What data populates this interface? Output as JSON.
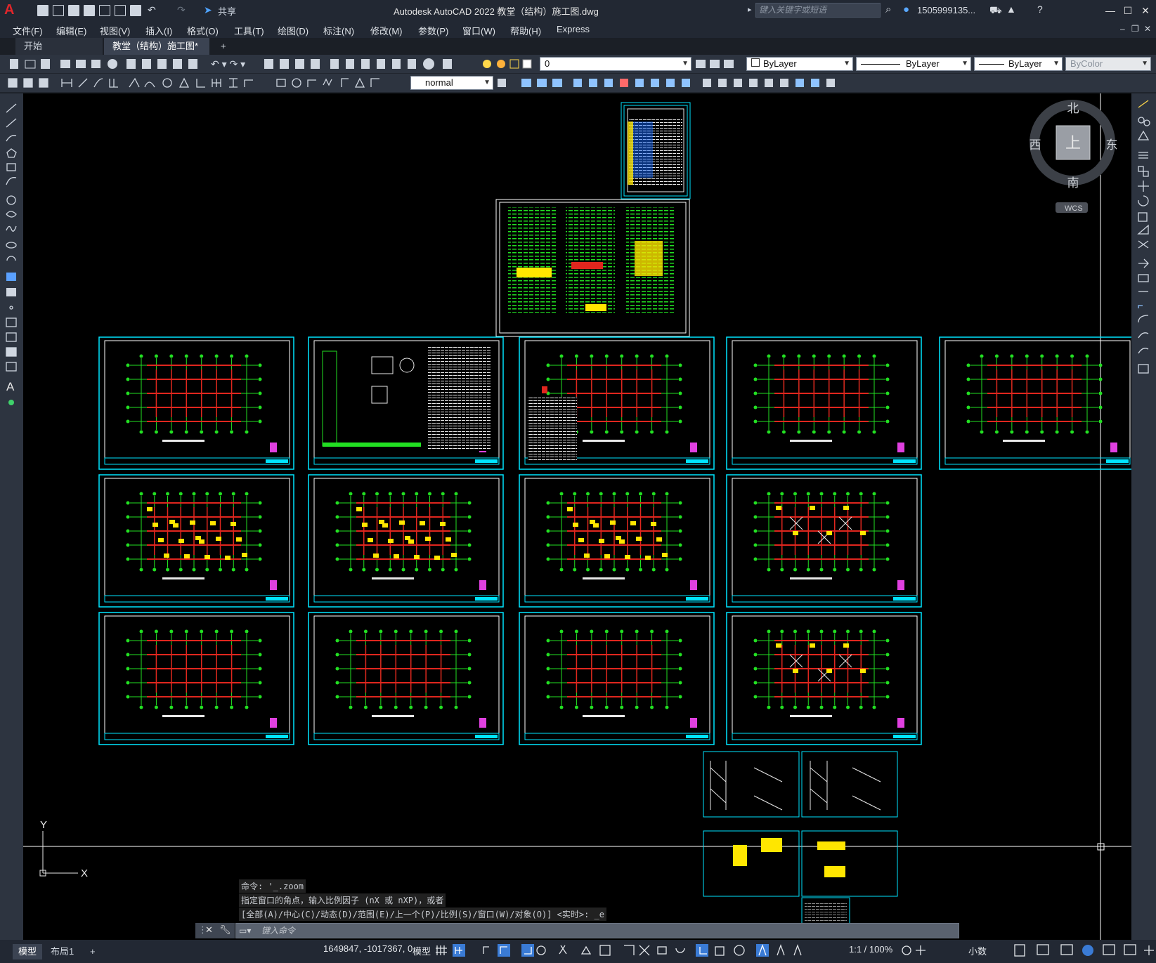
{
  "app": {
    "window_title": "Autodesk AutoCAD 2022    教堂（结构）施工图.dwg",
    "share_label": "共享",
    "search_placeholder": "键入关键字或短语",
    "user_name": "1505999135...",
    "logo_letter": "A"
  },
  "menu": [
    "文件(F)",
    "编辑(E)",
    "视图(V)",
    "插入(I)",
    "格式(O)",
    "工具(T)",
    "绘图(D)",
    "标注(N)",
    "修改(M)",
    "参数(P)",
    "窗口(W)",
    "帮助(H)",
    "Express"
  ],
  "tabs": {
    "start": "开始",
    "document": "教堂（结构）施工图*",
    "close": "×",
    "add": "+"
  },
  "properties": {
    "layer": "0",
    "color": "ByLayer",
    "linetype": "ByLayer",
    "lineweight": "ByLayer",
    "plotstyle": "ByColor",
    "dimstyle": "normal"
  },
  "viewcube": {
    "north": "北",
    "south": "南",
    "east": "东",
    "west": "西",
    "top": "上",
    "wcs": "WCS"
  },
  "ucs": {
    "x": "X",
    "y": "Y"
  },
  "command": {
    "history": [
      "命令: '_.zoom",
      "指定窗口的角点，输入比例因子 (nX 或 nXP)，或者",
      "[全部(A)/中心(C)/动态(D)/范围(E)/上一个(P)/比例(S)/窗口(W)/对象(O)] <实时>: _e"
    ],
    "placeholder": "键入命令"
  },
  "status": {
    "layout_tabs": [
      "模型",
      "布局1"
    ],
    "add_layout": "+",
    "coordinates": "1649847, -1017367, 0",
    "space": "模型",
    "scale": "1:1 / 100%",
    "units": "小数"
  },
  "colors": {
    "sheet_border": "#00e5ff",
    "red": "#e0261e",
    "green": "#22e022",
    "yellow": "#ffe600"
  }
}
